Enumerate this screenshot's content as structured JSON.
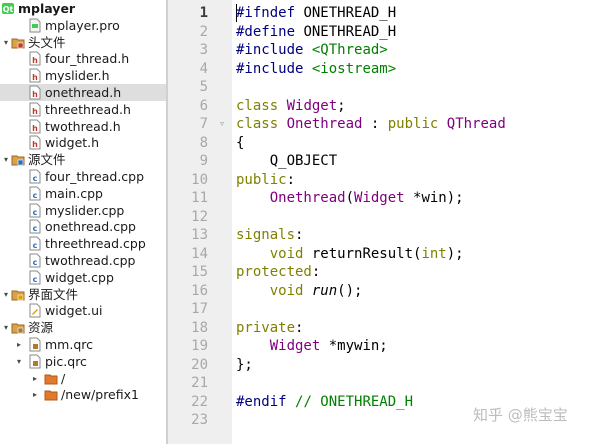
{
  "project_tree": {
    "items": [
      {
        "label": "mplayer",
        "depth": 0,
        "arrow": "",
        "icon": "qt-project-icon",
        "bold": true
      },
      {
        "label": "mplayer.pro",
        "depth": 1,
        "arrow": "",
        "icon": "pro-file-icon"
      },
      {
        "label": "头文件",
        "depth": 0,
        "arrow": "▾",
        "icon": "header-folder-icon"
      },
      {
        "label": "four_thread.h",
        "depth": 1,
        "arrow": "",
        "icon": "h-file-icon"
      },
      {
        "label": "myslider.h",
        "depth": 1,
        "arrow": "",
        "icon": "h-file-icon"
      },
      {
        "label": "onethread.h",
        "depth": 1,
        "arrow": "",
        "icon": "h-file-icon",
        "selected": true
      },
      {
        "label": "threethread.h",
        "depth": 1,
        "arrow": "",
        "icon": "h-file-icon"
      },
      {
        "label": "twothread.h",
        "depth": 1,
        "arrow": "",
        "icon": "h-file-icon"
      },
      {
        "label": "widget.h",
        "depth": 1,
        "arrow": "",
        "icon": "h-file-icon"
      },
      {
        "label": "源文件",
        "depth": 0,
        "arrow": "▾",
        "icon": "source-folder-icon"
      },
      {
        "label": "four_thread.cpp",
        "depth": 1,
        "arrow": "",
        "icon": "cpp-file-icon"
      },
      {
        "label": "main.cpp",
        "depth": 1,
        "arrow": "",
        "icon": "cpp-file-icon"
      },
      {
        "label": "myslider.cpp",
        "depth": 1,
        "arrow": "",
        "icon": "cpp-file-icon"
      },
      {
        "label": "onethread.cpp",
        "depth": 1,
        "arrow": "",
        "icon": "cpp-file-icon"
      },
      {
        "label": "threethread.cpp",
        "depth": 1,
        "arrow": "",
        "icon": "cpp-file-icon"
      },
      {
        "label": "twothread.cpp",
        "depth": 1,
        "arrow": "",
        "icon": "cpp-file-icon"
      },
      {
        "label": "widget.cpp",
        "depth": 1,
        "arrow": "",
        "icon": "cpp-file-icon"
      },
      {
        "label": "界面文件",
        "depth": 0,
        "arrow": "▾",
        "icon": "forms-folder-icon"
      },
      {
        "label": "widget.ui",
        "depth": 1,
        "arrow": "",
        "icon": "ui-file-icon"
      },
      {
        "label": "资源",
        "depth": 0,
        "arrow": "▾",
        "icon": "resources-folder-icon"
      },
      {
        "label": "mm.qrc",
        "depth": 1,
        "arrow": "▸",
        "icon": "qrc-file-icon"
      },
      {
        "label": "pic.qrc",
        "depth": 1,
        "arrow": "▾",
        "icon": "qrc-file-icon"
      },
      {
        "label": "/",
        "depth": 2,
        "arrow": "▸",
        "icon": "prefix-folder-icon"
      },
      {
        "label": "/new/prefix1",
        "depth": 2,
        "arrow": "▸",
        "icon": "prefix-folder-icon"
      }
    ]
  },
  "editor": {
    "file": "onethread.h",
    "current_line": 1,
    "fold_markers": {
      "7": "▿"
    },
    "lines": [
      [
        [
          "m",
          "#ifndef"
        ],
        [
          "p",
          " ONETHREAD_H"
        ]
      ],
      [
        [
          "m",
          "#define"
        ],
        [
          "p",
          " ONETHREAD_H"
        ]
      ],
      [
        [
          "m",
          "#include"
        ],
        [
          "p",
          " "
        ],
        [
          "s",
          "<QThread>"
        ]
      ],
      [
        [
          "m",
          "#include"
        ],
        [
          "p",
          " "
        ],
        [
          "s",
          "<iostream>"
        ]
      ],
      [],
      [
        [
          "k",
          "class"
        ],
        [
          "p",
          " "
        ],
        [
          "t",
          "Widget"
        ],
        [
          "p",
          ";"
        ]
      ],
      [
        [
          "k",
          "class"
        ],
        [
          "p",
          " "
        ],
        [
          "t",
          "Onethread"
        ],
        [
          "p",
          " : "
        ],
        [
          "k",
          "public"
        ],
        [
          "p",
          " "
        ],
        [
          "t",
          "QThread"
        ]
      ],
      [
        [
          "p",
          "{"
        ]
      ],
      [
        [
          "p",
          "    Q_OBJECT"
        ]
      ],
      [
        [
          "k",
          "public"
        ],
        [
          "p",
          ":"
        ]
      ],
      [
        [
          "p",
          "    "
        ],
        [
          "t",
          "Onethread"
        ],
        [
          "p",
          "("
        ],
        [
          "t",
          "Widget"
        ],
        [
          "p",
          " *win);"
        ]
      ],
      [],
      [
        [
          "k",
          "signals"
        ],
        [
          "p",
          ":"
        ]
      ],
      [
        [
          "p",
          "    "
        ],
        [
          "k",
          "void"
        ],
        [
          "p",
          " returnResult("
        ],
        [
          "k",
          "int"
        ],
        [
          "p",
          ");"
        ]
      ],
      [
        [
          "k",
          "protected"
        ],
        [
          "p",
          ":"
        ]
      ],
      [
        [
          "p",
          "    "
        ],
        [
          "k",
          "void"
        ],
        [
          "p",
          " "
        ],
        [
          "i",
          "run"
        ],
        [
          "p",
          "();"
        ]
      ],
      [],
      [
        [
          "k",
          "private"
        ],
        [
          "p",
          ":"
        ]
      ],
      [
        [
          "p",
          "    "
        ],
        [
          "t",
          "Widget"
        ],
        [
          "p",
          " *mywin;"
        ]
      ],
      [
        [
          "p",
          "};"
        ]
      ],
      [],
      [
        [
          "m",
          "#endif"
        ],
        [
          "p",
          " "
        ],
        [
          "c",
          "// ONETHREAD_H"
        ]
      ],
      []
    ]
  },
  "watermark": "知乎 @熊宝宝"
}
